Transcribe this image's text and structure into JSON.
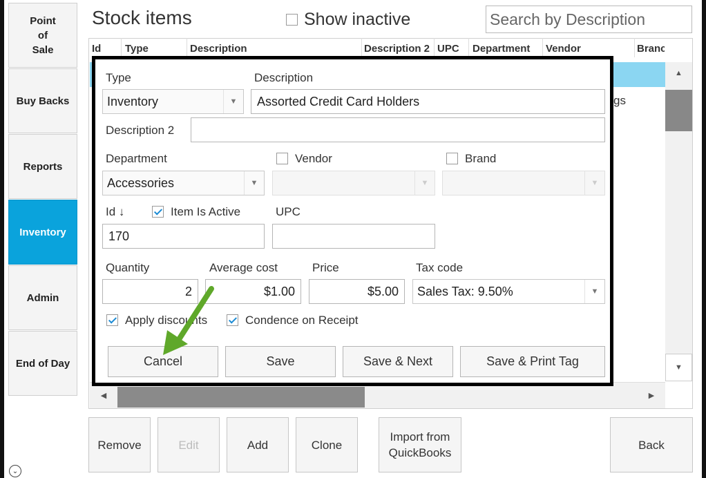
{
  "nav": {
    "items": [
      {
        "label": "Point\nof\nSale"
      },
      {
        "label": "Buy Backs"
      },
      {
        "label": "Reports"
      },
      {
        "label": "Inventory"
      },
      {
        "label": "Admin"
      },
      {
        "label": "End of Day"
      }
    ],
    "active": "Inventory"
  },
  "header": {
    "title": "Stock items",
    "show_inactive_label": "Show inactive",
    "show_inactive_checked": false,
    "search_placeholder": "Search by Description"
  },
  "grid": {
    "columns": [
      "Id",
      "Type",
      "Description",
      "Description 2",
      "UPC",
      "Department",
      "Vendor",
      "Branc"
    ],
    "row_fragment": "gs"
  },
  "dialog": {
    "type_label": "Type",
    "type_value": "Inventory",
    "description_label": "Description",
    "description_value": "Assorted Credit Card Holders",
    "description2_label": "Description 2",
    "description2_value": "",
    "department_label": "Department",
    "department_value": "Accessories",
    "vendor_label": "Vendor",
    "vendor_checked": false,
    "brand_label": "Brand",
    "brand_checked": false,
    "id_label": "Id ↓",
    "item_active_label": "Item Is Active",
    "item_active_checked": true,
    "upc_label": "UPC",
    "id_value": "170",
    "upc_value": "",
    "quantity_label": "Quantity",
    "quantity_value": "2",
    "avg_cost_label": "Average cost",
    "avg_cost_value": "$1.00",
    "price_label": "Price",
    "price_value": "$5.00",
    "tax_label": "Tax code",
    "tax_value": "Sales Tax: 9.50%",
    "apply_discounts_label": "Apply discounts",
    "apply_discounts_checked": true,
    "condence_label": "Condence on Receipt",
    "condence_checked": true,
    "buttons": {
      "cancel": "Cancel",
      "save": "Save",
      "save_next": "Save & Next",
      "save_print": "Save & Print Tag"
    }
  },
  "bottom": {
    "remove": "Remove",
    "edit": "Edit",
    "add": "Add",
    "clone": "Clone",
    "import": "Import from\nQuickBooks",
    "back": "Back"
  },
  "colors": {
    "accent": "#0aa3dc",
    "selected_row": "#8bd6f2",
    "annotation_arrow": "#5fa82a"
  }
}
